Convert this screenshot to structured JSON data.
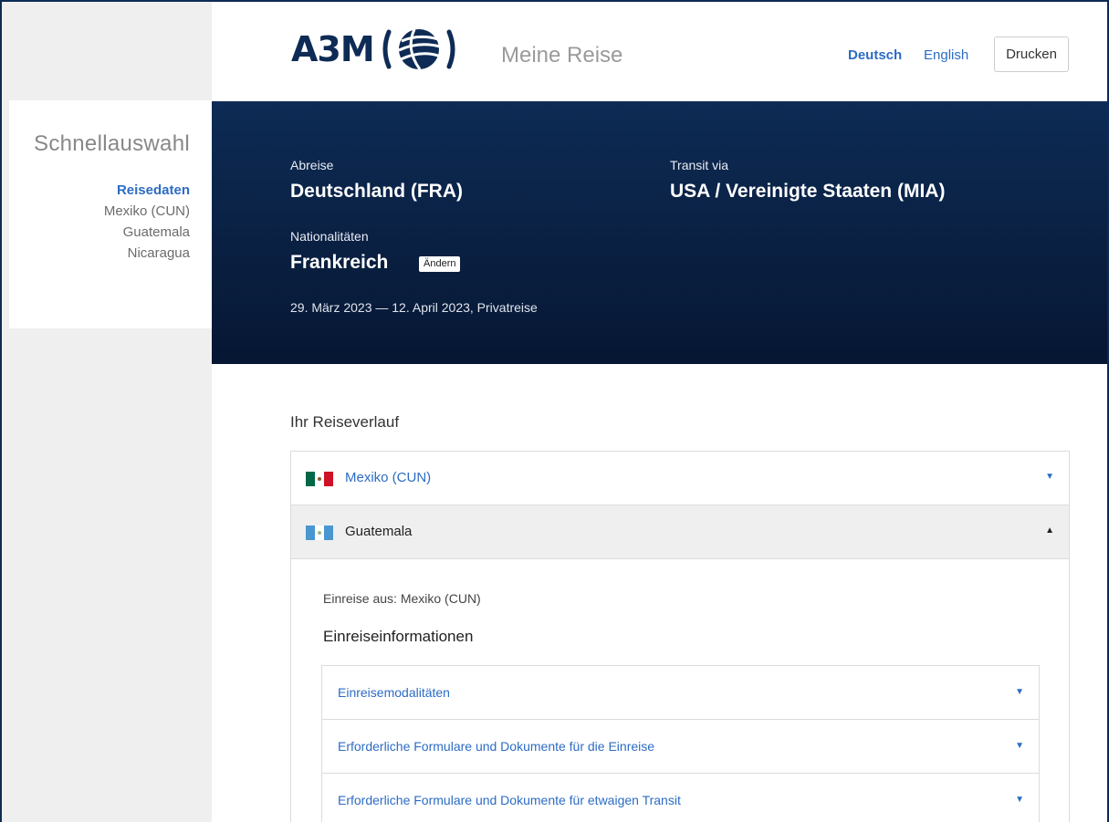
{
  "sidebar": {
    "title": "Schnellauswahl",
    "items": [
      {
        "label": "Reisedaten",
        "active": true
      },
      {
        "label": "Mexiko (CUN)",
        "active": false
      },
      {
        "label": "Guatemala",
        "active": false
      },
      {
        "label": "Nicaragua",
        "active": false
      }
    ]
  },
  "header": {
    "logo_text": "A3M",
    "app_title": "Meine Reise",
    "lang_de": "Deutsch",
    "lang_en": "English",
    "print_label": "Drucken"
  },
  "trip": {
    "departure_label": "Abreise",
    "departure_value": "Deutschland (FRA)",
    "transit_label": "Transit via",
    "transit_value": "USA / Vereinigte Staaten (MIA)",
    "nationality_label": "Nationalitäten",
    "nationality_value": "Frankreich",
    "change_label": "Ändern",
    "dates": "29. März 2023 — 12. April 2023, Privatreise"
  },
  "itinerary": {
    "title": "Ihr Reiseverlauf",
    "stops": [
      {
        "label": "Mexiko (CUN)",
        "expanded": false,
        "flag": "mexico-flag",
        "caret": "▼"
      },
      {
        "label": "Guatemala",
        "expanded": true,
        "flag": "guatemala-flag",
        "caret": "▲"
      }
    ],
    "open_stop": {
      "origin": "Einreise aus: Mexiko (CUN)",
      "section_title": "Einreiseinformationen",
      "items": [
        {
          "label": "Einreisemodalitäten",
          "caret": "▼"
        },
        {
          "label": "Erforderliche Formulare und Dokumente für die Einreise",
          "caret": "▼"
        },
        {
          "label": "Erforderliche Formulare und Dokumente für etwaigen Transit",
          "caret": "▼"
        }
      ]
    }
  },
  "colors": {
    "brand_navy": "#0d2b55",
    "link_blue": "#2c6cc4",
    "sidebar_bg": "#efefef",
    "open_row_bg": "#efefef"
  }
}
